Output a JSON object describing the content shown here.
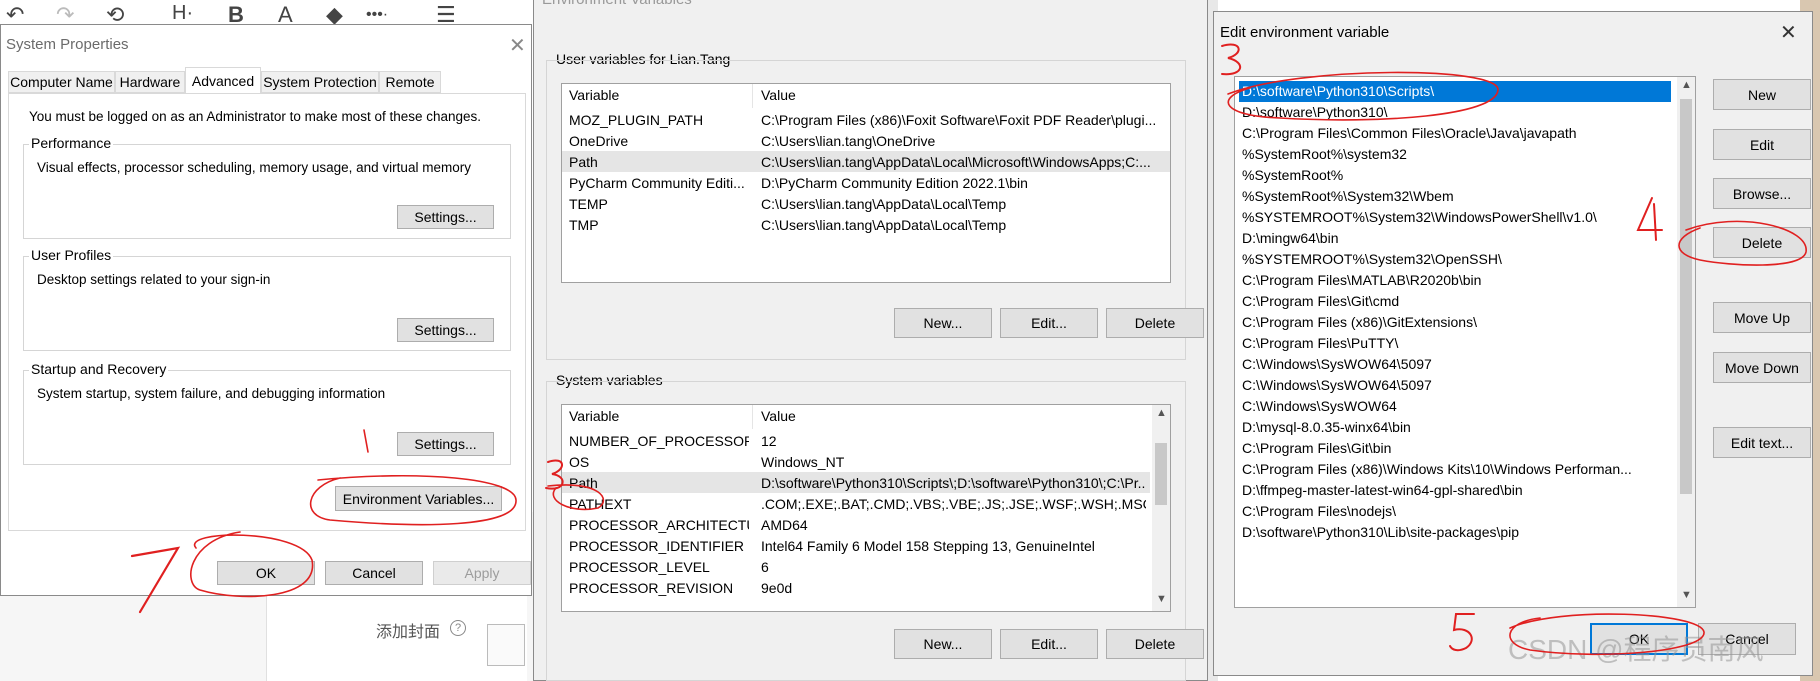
{
  "toolbar": {
    "icons": [
      "undo-icon",
      "redo-icon",
      "history-icon",
      "heading-icon",
      "bold-icon",
      "font-color-icon",
      "paint-bucket-icon",
      "more-icon",
      "list-icon"
    ],
    "heading_label": "H·",
    "bold_label": "B",
    "font_label": "A",
    "more_label": "•••·",
    "list_label": "☰"
  },
  "system_properties": {
    "title": "System Properties",
    "tabs": [
      "Computer Name",
      "Hardware",
      "Advanced",
      "System Protection",
      "Remote"
    ],
    "active_tab": "Advanced",
    "admin_note": "You must be logged on as an Administrator to make most of these changes.",
    "performance": {
      "label": "Performance",
      "description": "Visual effects, processor scheduling, memory usage, and virtual memory",
      "button": "Settings..."
    },
    "user_profiles": {
      "label": "User Profiles",
      "description": "Desktop settings related to your sign-in",
      "button": "Settings..."
    },
    "startup": {
      "label": "Startup and Recovery",
      "description": "System startup, system failure, and debugging information",
      "button": "Settings..."
    },
    "env_button": "Environment Variables...",
    "ok": "OK",
    "cancel": "Cancel",
    "apply": "Apply"
  },
  "environment_variables": {
    "title": "Environment Variables",
    "user_section": "User variables for Lian.Tang",
    "columns": [
      "Variable",
      "Value"
    ],
    "user_vars": [
      {
        "name": "MOZ_PLUGIN_PATH",
        "value": "C:\\Program Files (x86)\\Foxit Software\\Foxit PDF Reader\\plugi..."
      },
      {
        "name": "OneDrive",
        "value": "C:\\Users\\lian.tang\\OneDrive"
      },
      {
        "name": "Path",
        "value": "C:\\Users\\lian.tang\\AppData\\Local\\Microsoft\\WindowsApps;C:..."
      },
      {
        "name": "PyCharm Community Editi...",
        "value": "D:\\PyCharm Community Edition 2022.1\\bin"
      },
      {
        "name": "TEMP",
        "value": "C:\\Users\\lian.tang\\AppData\\Local\\Temp"
      },
      {
        "name": "TMP",
        "value": "C:\\Users\\lian.tang\\AppData\\Local\\Temp"
      }
    ],
    "user_buttons": {
      "new": "New...",
      "edit": "Edit...",
      "delete": "Delete"
    },
    "system_section": "System variables",
    "system_vars": [
      {
        "name": "NUMBER_OF_PROCESSORS",
        "value": "12"
      },
      {
        "name": "OS",
        "value": "Windows_NT"
      },
      {
        "name": "Path",
        "value": "D:\\software\\Python310\\Scripts\\;D:\\software\\Python310\\;C:\\Pr..."
      },
      {
        "name": "PATHEXT",
        "value": ".COM;.EXE;.BAT;.CMD;.VBS;.VBE;.JS;.JSE;.WSF;.WSH;.MSC;.PY;.PYW"
      },
      {
        "name": "PROCESSOR_ARCHITECTU...",
        "value": "AMD64"
      },
      {
        "name": "PROCESSOR_IDENTIFIER",
        "value": "Intel64 Family 6 Model 158 Stepping 13, GenuineIntel"
      },
      {
        "name": "PROCESSOR_LEVEL",
        "value": "6"
      },
      {
        "name": "PROCESSOR_REVISION",
        "value": "9e0d"
      }
    ],
    "system_buttons": {
      "new": "New...",
      "edit": "Edit...",
      "delete": "Delete"
    }
  },
  "edit_env": {
    "title": "Edit environment variable",
    "paths": [
      "D:\\software\\Python310\\Scripts\\",
      "D:\\software\\Python310\\",
      "C:\\Program Files\\Common Files\\Oracle\\Java\\javapath",
      "%SystemRoot%\\system32",
      "%SystemRoot%",
      "%SystemRoot%\\System32\\Wbem",
      "%SYSTEMROOT%\\System32\\WindowsPowerShell\\v1.0\\",
      "D:\\mingw64\\bin",
      "%SYSTEMROOT%\\System32\\OpenSSH\\",
      "C:\\Program Files\\MATLAB\\R2020b\\bin",
      "C:\\Program Files\\Git\\cmd",
      "C:\\Program Files (x86)\\GitExtensions\\",
      "C:\\Program Files\\PuTTY\\",
      "C:\\Windows\\SysWOW64\\5097",
      "C:\\Windows\\SysWOW64\\5097",
      "C:\\Windows\\SysWOW64",
      "D:\\mysql-8.0.35-winx64\\bin",
      "C:\\Program Files\\Git\\bin",
      "C:\\Program Files (x86)\\Windows Kits\\10\\Windows Performan...",
      "D:\\ffmpeg-master-latest-win64-gpl-shared\\bin",
      "C:\\Program Files\\nodejs\\",
      "D:\\software\\Python310\\Lib\\site-packages\\pip"
    ],
    "buttons": {
      "new": "New",
      "edit": "Edit",
      "browse": "Browse...",
      "delete": "Delete",
      "move_up": "Move Up",
      "move_down": "Move Down",
      "edit_text": "Edit text..."
    },
    "ok": "OK",
    "cancel": "Cancel"
  },
  "background": {
    "cover_label": "添加封面",
    "help_icon": "?",
    "watermark": "CSDN @程序员南风"
  },
  "annotations": [
    "1",
    "2",
    "3",
    "4",
    "5",
    "7"
  ],
  "colors": {
    "selection": "#0078d7",
    "annotation": "#e02020",
    "dialog_bg": "#f0f0f0"
  }
}
